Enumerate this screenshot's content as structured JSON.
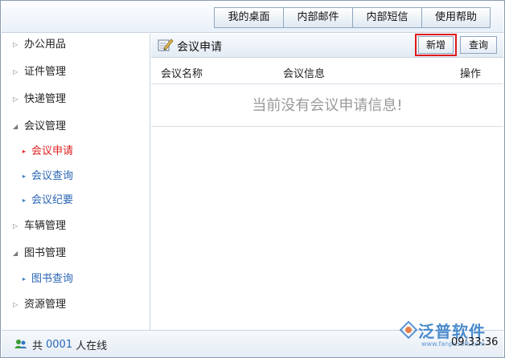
{
  "topnav": {
    "items": [
      "我的桌面",
      "内部邮件",
      "内部短信",
      "使用帮助"
    ]
  },
  "sidebar": {
    "items": [
      {
        "label": "办公用品",
        "expanded": false
      },
      {
        "label": "证件管理",
        "expanded": false
      },
      {
        "label": "快递管理",
        "expanded": false
      },
      {
        "label": "会议管理",
        "expanded": true,
        "children": [
          "会议申请",
          "会议查询",
          "会议纪要"
        ],
        "active_child": "会议申请"
      },
      {
        "label": "车辆管理",
        "expanded": false
      },
      {
        "label": "图书管理",
        "expanded": true,
        "children": [
          "图书查询"
        ]
      },
      {
        "label": "资源管理",
        "expanded": false
      }
    ]
  },
  "panel": {
    "title": "会议申请",
    "add_label": "新增",
    "query_label": "查询",
    "columns": [
      "会议名称",
      "会议信息",
      "操作"
    ],
    "empty_message": "当前没有会议申请信息!"
  },
  "status": {
    "prefix": "共",
    "count": "0001",
    "suffix": "人在线",
    "time": "09:33:36"
  },
  "watermark": {
    "brand": "泛普软件",
    "url": "www.fanpusoft.com"
  },
  "colors": {
    "link": "#2a66b5",
    "active": "#e02020",
    "highlight_ring": "#e01818",
    "brand": "#2f78c4"
  }
}
